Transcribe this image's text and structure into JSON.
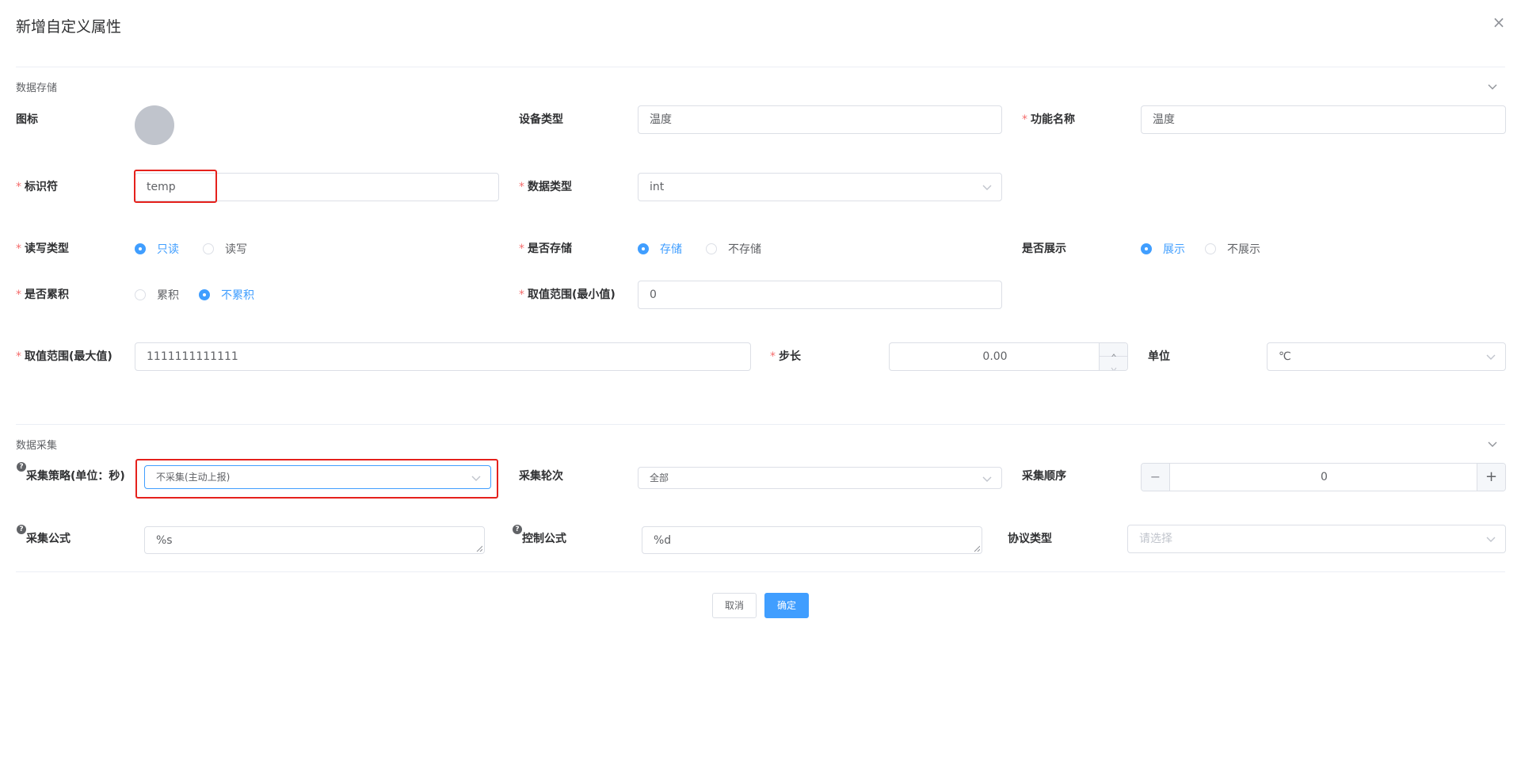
{
  "dialog": {
    "title": "新增自定义属性",
    "close_icon": "×"
  },
  "storage": {
    "section_title": "数据存储",
    "icon_label": "图标",
    "device_type_label": "设备类型",
    "device_type_value": "温度",
    "function_name_label": "功能名称",
    "function_name_value": "温度",
    "identifier_label": "标识符",
    "identifier_value": "temp",
    "data_type_label": "数据类型",
    "data_type_value": "int",
    "rw_label": "读写类型",
    "rw_options": [
      "只读",
      "读写"
    ],
    "rw_selected": 0,
    "store_label": "是否存储",
    "store_options": [
      "存储",
      "不存储"
    ],
    "store_selected": 0,
    "show_label": "是否展示",
    "show_options": [
      "展示",
      "不展示"
    ],
    "show_selected": 0,
    "accum_label": "是否累积",
    "accum_options": [
      "累积",
      "不累积"
    ],
    "accum_selected": 1,
    "min_label": "取值范围(最小值)",
    "min_value": "0",
    "max_label": "取值范围(最大值)",
    "max_value": "1111111111111",
    "step_label": "步长",
    "step_value": "0.00",
    "unit_label": "单位",
    "unit_value": "℃"
  },
  "collect": {
    "section_title": "数据采集",
    "strategy_label": "采集策略(单位：秒)",
    "strategy_value": "不采集(主动上报)",
    "round_label": "采集轮次",
    "round_value": "全部",
    "order_label": "采集顺序",
    "order_value": "0",
    "order_minus": "−",
    "order_plus": "+",
    "formula_label": "采集公式",
    "formula_value": "%s",
    "control_label": "控制公式",
    "control_value": "%d",
    "protocol_label": "协议类型",
    "protocol_placeholder": "请选择",
    "help_icon": "?"
  },
  "footer": {
    "cancel": "取消",
    "confirm": "确定"
  },
  "colors": {
    "primary": "#409eff",
    "highlight": "#e5211c",
    "required": "#f56c6c"
  }
}
